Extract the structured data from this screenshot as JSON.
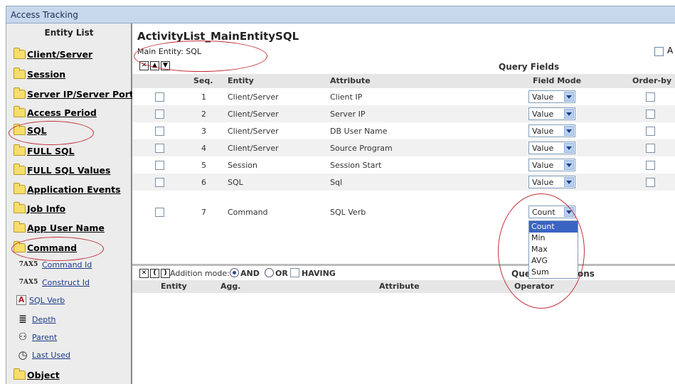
{
  "window": {
    "title": "Access Tracking"
  },
  "sidebar": {
    "header": "Entity List",
    "entities": [
      "Client/Server",
      "Session",
      "Server IP/Server Port",
      "Access Period",
      "SQL",
      "FULL SQL",
      "FULL SQL Values",
      "Application Events",
      "Job Info",
      "App User Name",
      "Command",
      "Object"
    ],
    "fields": [
      {
        "icon_text": "7AX5",
        "label": "Command Id"
      },
      {
        "icon_text": "7AX5",
        "label": "Construct Id"
      },
      {
        "icon_text": "A",
        "label": "SQL Verb"
      },
      {
        "icon_text": "≣",
        "label": "Depth"
      },
      {
        "icon_text": "⚇",
        "label": "Parent"
      },
      {
        "icon_text": "◷",
        "label": "Last Used"
      }
    ]
  },
  "main": {
    "title": "ActivityList_MainEntitySQL",
    "main_entity": "Main Entity: SQL",
    "top_right_label": "A",
    "query_fields_label": "Query Fields",
    "columns": {
      "seq": "Seq.",
      "entity": "Entity",
      "attribute": "Attribute",
      "field_mode": "Field Mode",
      "order_by": "Order-by"
    },
    "rows": [
      {
        "seq": "1",
        "entity": "Client/Server",
        "attribute": "Client IP",
        "mode": "Value"
      },
      {
        "seq": "2",
        "entity": "Client/Server",
        "attribute": "Server IP",
        "mode": "Value"
      },
      {
        "seq": "3",
        "entity": "Client/Server",
        "attribute": "DB User Name",
        "mode": "Value"
      },
      {
        "seq": "4",
        "entity": "Client/Server",
        "attribute": "Source Program",
        "mode": "Value"
      },
      {
        "seq": "5",
        "entity": "Session",
        "attribute": "Session Start",
        "mode": "Value"
      },
      {
        "seq": "6",
        "entity": "SQL",
        "attribute": "Sql",
        "mode": "Value"
      },
      {
        "seq": "7",
        "entity": "Command",
        "attribute": "SQL Verb",
        "mode": "Count"
      }
    ],
    "dropdown_options": [
      "Count",
      "Min",
      "Max",
      "AVG",
      "Sum"
    ],
    "dropdown_selected": "Count"
  },
  "conditions": {
    "addition_mode_label": "Addition mode:",
    "and_label": "AND",
    "or_label": "OR",
    "having_label": "HAVING",
    "query_conditions_label": "Query Conditions",
    "columns": {
      "entity": "Entity",
      "agg": "Agg.",
      "attribute": "Attribute",
      "operator": "Operator"
    }
  },
  "colors": {
    "annotation": "#c0303a",
    "dropdown_highlight": "#3b63c3",
    "titlebar": "#c8d8ec"
  }
}
